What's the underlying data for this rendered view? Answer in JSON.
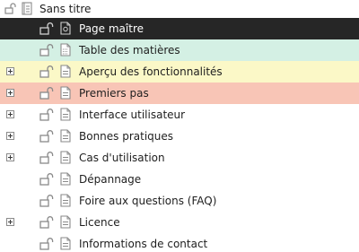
{
  "tree": {
    "root": {
      "label": "Sans titre",
      "icons": [
        "unlock-icon",
        "notebook-icon"
      ]
    },
    "items": [
      {
        "label": "Page maître",
        "expandable": false,
        "style": "dark",
        "doc_icon": "master-page-icon"
      },
      {
        "label": "Table des matières",
        "expandable": false,
        "style": "green",
        "doc_icon": "toc-page-icon"
      },
      {
        "label": "Aperçu des fonctionnalités",
        "expandable": true,
        "style": "yellow",
        "doc_icon": "page-icon"
      },
      {
        "label": "Premiers pas",
        "expandable": true,
        "style": "red",
        "doc_icon": "page-icon"
      },
      {
        "label": "Interface utilisateur",
        "expandable": true,
        "style": "none",
        "doc_icon": "page-icon"
      },
      {
        "label": "Bonnes pratiques",
        "expandable": true,
        "style": "none",
        "doc_icon": "page-icon"
      },
      {
        "label": "Cas d'utilisation",
        "expandable": true,
        "style": "none",
        "doc_icon": "page-icon"
      },
      {
        "label": "Dépannage",
        "expandable": false,
        "style": "none",
        "doc_icon": "page-icon"
      },
      {
        "label": "Foire aux questions (FAQ)",
        "expandable": false,
        "style": "none",
        "doc_icon": "page-icon"
      },
      {
        "label": "Licence",
        "expandable": true,
        "style": "none",
        "doc_icon": "page-icon"
      },
      {
        "label": "Informations de contact",
        "expandable": false,
        "style": "none",
        "doc_icon": "page-icon"
      }
    ]
  },
  "colors": {
    "dark": "#262626",
    "green": "#d4f0e4",
    "yellow": "#fbf8c7",
    "red": "#f8c5b6"
  }
}
